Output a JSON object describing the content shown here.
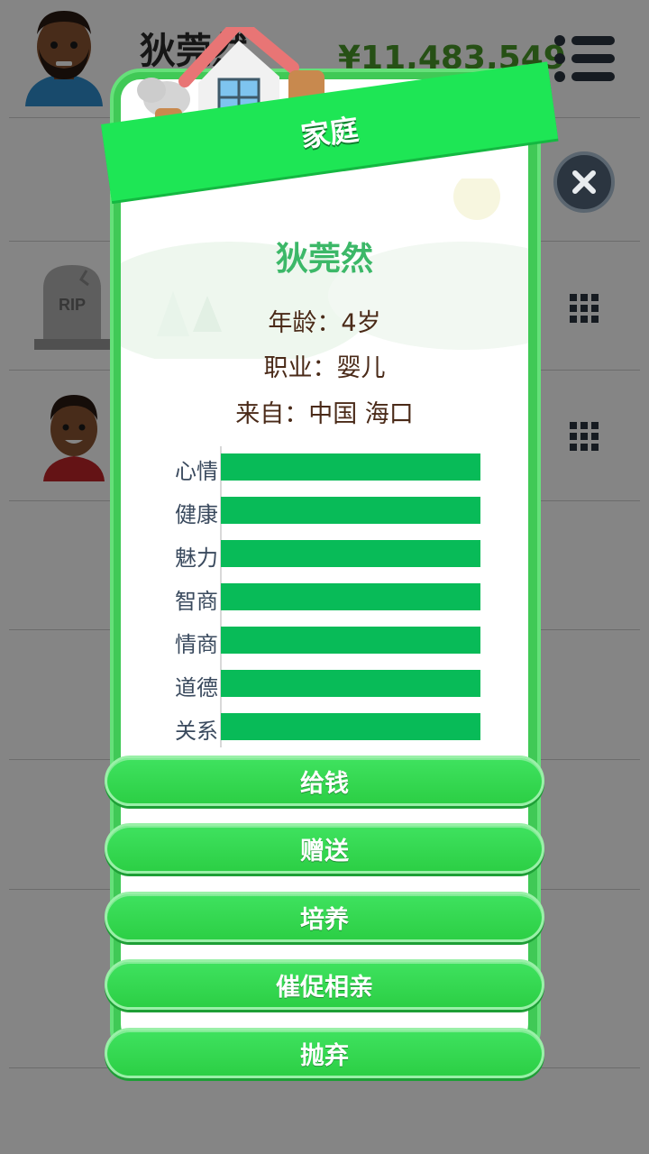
{
  "background": {
    "player_name": "狄莞然",
    "money": "¥11,483,549"
  },
  "modal": {
    "banner_title": "家庭",
    "person_name": "狄莞然",
    "age_line": "年龄：4岁",
    "job_line": "职业：婴儿",
    "from_line": "来自：中国 海口",
    "stats": [
      {
        "label": "心情",
        "value": 1.0
      },
      {
        "label": "健康",
        "value": 1.0
      },
      {
        "label": "魅力",
        "value": 1.0
      },
      {
        "label": "智商",
        "value": 1.0
      },
      {
        "label": "情商",
        "value": 1.0
      },
      {
        "label": "道德",
        "value": 1.0
      },
      {
        "label": "关系",
        "value": 1.0
      }
    ],
    "buttons": [
      "给钱",
      "赠送",
      "培养",
      "催促相亲",
      "抛弃"
    ]
  },
  "colors": {
    "accent_green": "#08bb58",
    "button_green": "#2ccf45",
    "name_green": "#3cb868"
  },
  "icons": [
    "menu-icon",
    "close-icon",
    "grid-icon",
    "rip-tombstone-icon",
    "house-icon"
  ]
}
